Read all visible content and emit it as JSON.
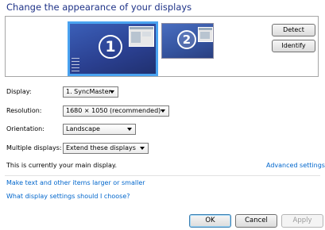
{
  "title": "Change the appearance of your displays",
  "preview": {
    "monitors": [
      {
        "number": "1",
        "selected": true
      },
      {
        "number": "2",
        "selected": false
      }
    ],
    "detect_label": "Detect",
    "identify_label": "Identify"
  },
  "settings": {
    "display_label": "Display:",
    "display_value": "1. SyncMaster",
    "resolution_label": "Resolution:",
    "resolution_value": "1680 × 1050 (recommended)",
    "orientation_label": "Orientation:",
    "orientation_value": "Landscape",
    "multiple_label": "Multiple displays:",
    "multiple_value": "Extend these displays"
  },
  "main_display_text": "This is currently your main display.",
  "advanced_settings_link": "Advanced settings",
  "links": {
    "text_size": "Make text and other items larger or smaller",
    "which_settings": "What display settings should I choose?"
  },
  "buttons": {
    "ok": "OK",
    "cancel": "Cancel",
    "apply": "Apply"
  },
  "colors": {
    "title": "#1e3287",
    "link": "#0066cc",
    "selected_border": "#4aa3f0"
  }
}
